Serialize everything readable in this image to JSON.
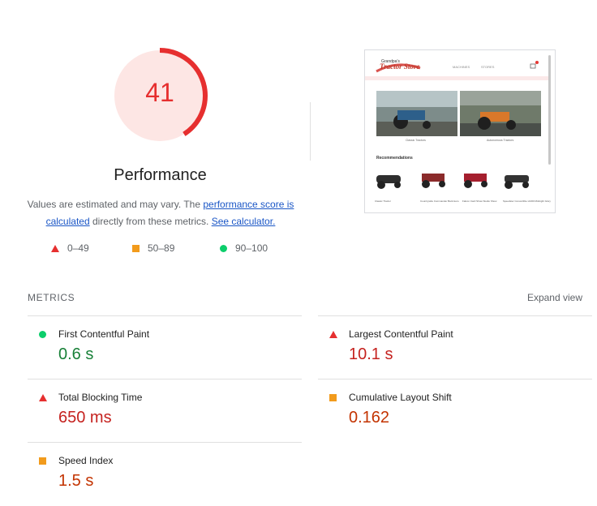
{
  "score": {
    "value": "41",
    "fraction": 0.41,
    "color": "#e62f2f",
    "bg": "#fde6e4"
  },
  "performance": {
    "title": "Performance",
    "desc_part1": "Values are estimated and may vary. The ",
    "link1": "performance score is calculated",
    "desc_part2": " directly from these metrics. ",
    "link2": "See calculator."
  },
  "legend": [
    {
      "icon": "triangle",
      "label": "0–49",
      "color": "#e62f2f"
    },
    {
      "icon": "square",
      "label": "50–89",
      "color": "#f29b1c"
    },
    {
      "icon": "circle",
      "label": "90–100",
      "color": "#0cce6b"
    }
  ],
  "screenshot": {
    "logo_small": "Grandpa's",
    "logo_main": "Tractor Store",
    "nav": [
      "MACHINES",
      "STORES"
    ],
    "products": [
      "Classic Tractors",
      "Autonomous Tractors"
    ],
    "section": "Recommendations",
    "recs": [
      "Classic Tractor",
      "Countryside Commander Bark Hero",
      "Falcon Card Show Studio Show",
      "Speedster Convertible x1000 Midnight Glory"
    ]
  },
  "metrics": {
    "label": "METRICS",
    "expand": "Expand view",
    "items": [
      {
        "name": "First Contentful Paint",
        "value": "0.6 s",
        "status": "good"
      },
      {
        "name": "Largest Contentful Paint",
        "value": "10.1 s",
        "status": "poor"
      },
      {
        "name": "Total Blocking Time",
        "value": "650 ms",
        "status": "poor"
      },
      {
        "name": "Cumulative Layout Shift",
        "value": "0.162",
        "status": "average"
      },
      {
        "name": "Speed Index",
        "value": "1.5 s",
        "status": "average"
      }
    ]
  }
}
